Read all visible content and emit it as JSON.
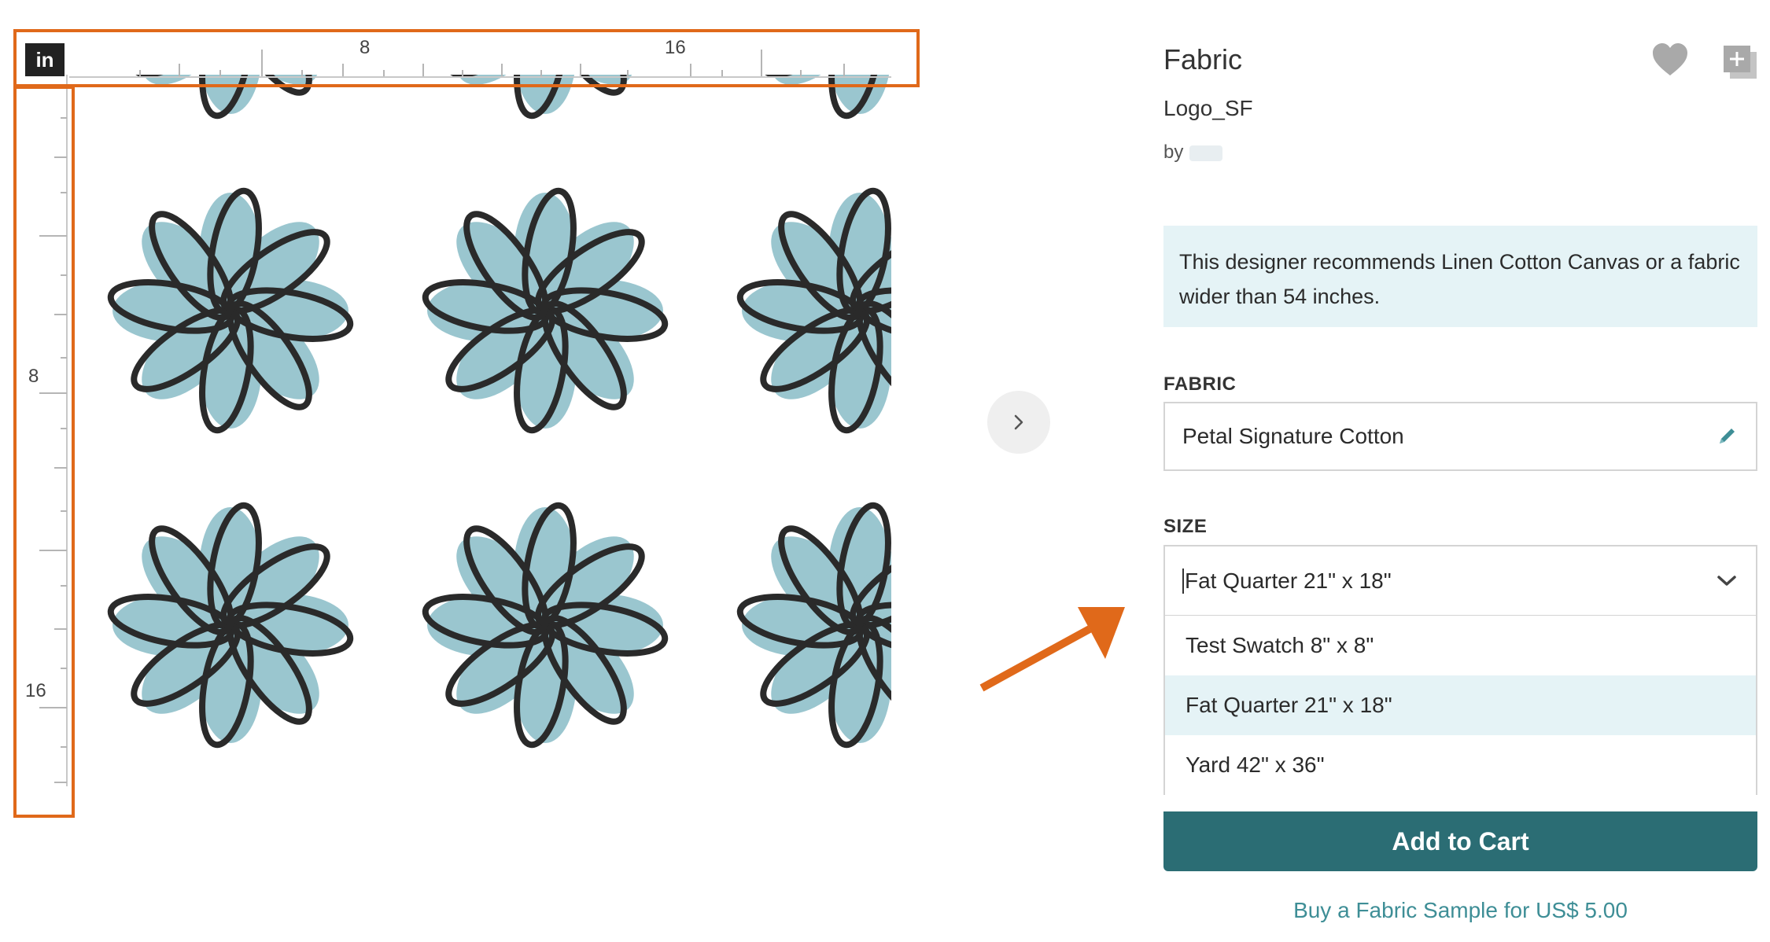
{
  "ruler": {
    "unit": "in",
    "top_marks": [
      "8",
      "16"
    ],
    "left_marks": [
      "8",
      "16"
    ]
  },
  "product": {
    "title": "Fabric",
    "design_name": "Logo_SF",
    "by_label": "by",
    "recommendation": "This designer recommends Linen Cotton Canvas or a fabric wider than 54 inches."
  },
  "fabric": {
    "label": "FABRIC",
    "value": "Petal Signature Cotton"
  },
  "size": {
    "label": "SIZE",
    "selected": "Fat Quarter 21\" x 18\"",
    "options": [
      "Test Swatch 8\" x 8\"",
      "Fat Quarter 21\" x 18\"",
      "Yard 42\" x 36\""
    ]
  },
  "actions": {
    "add_to_cart": "Add to Cart",
    "buy_sample": "Buy a Fabric Sample for US$ 5.00"
  },
  "colors": {
    "accent_orange": "#e0691a",
    "cart_button": "#2b6d74",
    "highlight_bg": "#e5f3f6",
    "flower_fill": "#9ac6cf",
    "link": "#3e8e96"
  },
  "icons": {
    "next": "chevron-right-icon",
    "favorite": "heart-icon",
    "collection": "add-to-collection-icon",
    "edit": "pencil-icon",
    "dropdown": "chevron-down-icon"
  }
}
